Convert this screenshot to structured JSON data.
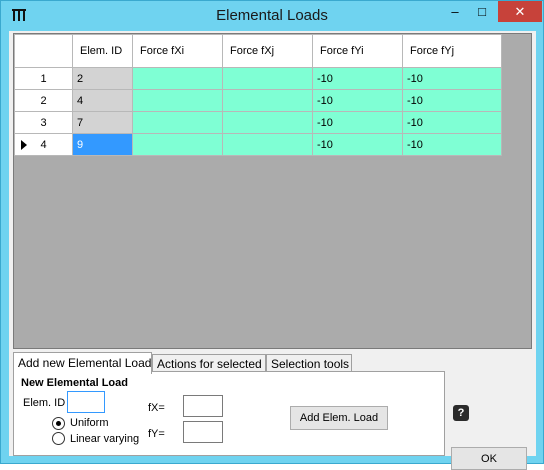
{
  "window": {
    "title": "Elemental Loads",
    "minimize": "–",
    "maximize": "□",
    "close": "✕"
  },
  "grid": {
    "columns": [
      "Elem. ID",
      "Force fXi",
      "Force fXj",
      "Force fYi",
      "Force fYj"
    ],
    "rows": [
      {
        "num": "1",
        "id": "2",
        "fxi": "",
        "fxj": "",
        "fyi": "-10",
        "fyj": "-10"
      },
      {
        "num": "2",
        "id": "4",
        "fxi": "",
        "fxj": "",
        "fyi": "-10",
        "fyj": "-10"
      },
      {
        "num": "3",
        "id": "7",
        "fxi": "",
        "fxj": "",
        "fyi": "-10",
        "fyj": "-10"
      },
      {
        "num": "4",
        "id": "9",
        "fxi": "",
        "fxj": "",
        "fyi": "-10",
        "fyj": "-10"
      }
    ]
  },
  "tabs": [
    "Add new Elemental Load",
    "Actions for selected",
    "Selection tools"
  ],
  "panel": {
    "title": "New Elemental Load",
    "elem_id_label": "Elem. ID",
    "elem_id_value": "",
    "uniform_label": "Uniform",
    "linear_label": "Linear varying",
    "fx_label": "fX=",
    "fy_label": "fY=",
    "fx_value": "",
    "fy_value": "",
    "add_button": "Add Elem. Load"
  },
  "help_icon": "?",
  "ok_button": "OK",
  "colors": {
    "titlebar": "#6fd3f0",
    "close": "#c7423a",
    "cell_green": "#7fffd4",
    "cell_selected": "#3399ff"
  }
}
